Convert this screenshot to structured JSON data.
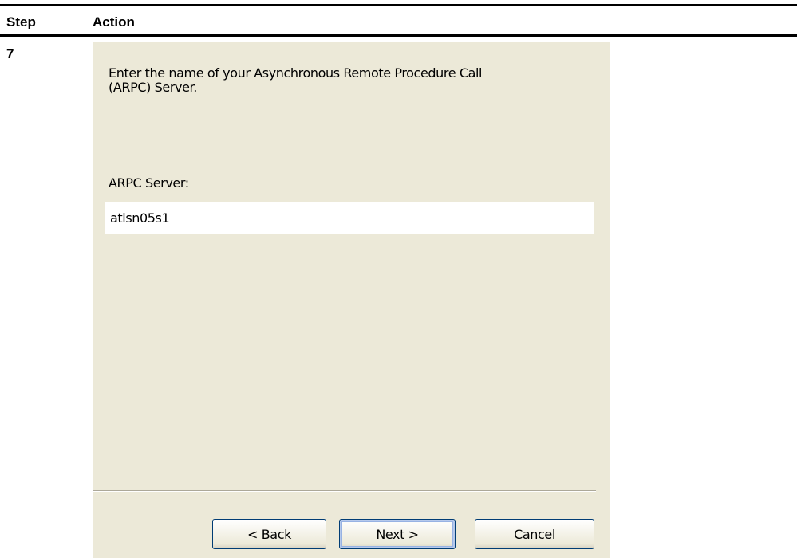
{
  "table": {
    "header_step": "Step",
    "header_action": "Action",
    "step_number": "7"
  },
  "wizard": {
    "instruction_line1": "Enter the name of your Asynchronous Remote Procedure Call",
    "instruction_line2": "(ARPC) Server.",
    "server_label": "ARPC Server:",
    "server_value": "atlsn05s1",
    "buttons": {
      "back": "< Back",
      "next": "Next >",
      "cancel": "Cancel"
    }
  }
}
